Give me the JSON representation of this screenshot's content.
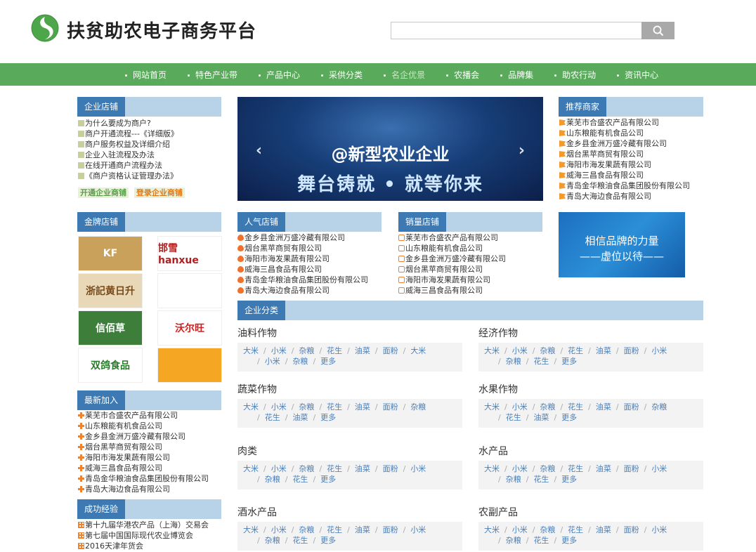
{
  "header": {
    "title": "扶贫助农电子商务平台",
    "search": {
      "value": "",
      "placeholder": ""
    },
    "search_icon": "search-icon"
  },
  "nav": {
    "items": [
      "网站首页",
      "特色产业带",
      "产品中心",
      "采供分类",
      "名企优景",
      "农播会",
      "品牌集",
      "助农行动",
      "资讯中心"
    ],
    "active": "名企优景"
  },
  "shop_intro": {
    "title": "企业店铺",
    "items": [
      "为什么要成为商户?",
      "商户开通流程---《详细版》",
      "商户服务权益及详细介绍",
      "企业入驻流程及办法",
      "在线开通商户流程办法",
      "《商户资格认证管理办法》"
    ],
    "promo": [
      "开通企业商铺",
      "登录企业商铺"
    ]
  },
  "gold_shops": {
    "title": "金牌店铺",
    "brands": [
      {
        "text": "KF",
        "bg": "#c9a15a",
        "color": "#fff"
      },
      {
        "text": "邯雪 hanxue",
        "bg": "#ffffff",
        "color": "#b02020"
      },
      {
        "text": "浙記黄日升",
        "bg": "#e9d8b8",
        "color": "#7a4a1a"
      },
      {
        "text": "",
        "bg": "#ffffff",
        "color": "#c02020"
      },
      {
        "text": "信佰草",
        "bg": "#3d7f3a",
        "color": "#ffffff"
      },
      {
        "text": "沃尔旺",
        "bg": "#ffffff",
        "color": "#d02020"
      },
      {
        "text": "双鸽食品",
        "bg": "#ffffff",
        "color": "#2b7a2b"
      },
      {
        "text": "",
        "bg": "#f5a623",
        "color": "#ffffff"
      }
    ]
  },
  "banner": {
    "line1": "@新型农业企业",
    "line2": "舞台铸就 • 就等你来",
    "prev_icon": "chevron-left-icon",
    "next_icon": "chevron-right-icon"
  },
  "recommend": {
    "title": "推荐商家",
    "items": [
      "莱芜市合盛农产品有限公司",
      "山东粮能有机食品公司",
      "金乡县金洲万盛冷藏有限公司",
      "烟台黑苹商贸有限公司",
      "海阳市海发果蔬有限公司",
      "威海三昌食品有限公司",
      "青岛金华粮油食品集团股份有限公司",
      "青岛大海边食品有限公司"
    ]
  },
  "popular": {
    "title": "人气店铺",
    "items": [
      "金乡县金洲万盛冷藏有限公司",
      "烟台黑苹商贸有限公司",
      "海阳市海发果蔬有限公司",
      "威海三昌食品有限公司",
      "青岛金华粮油食品集团股份有限公司",
      "青岛大海边食品有限公司"
    ]
  },
  "sales": {
    "title": "销量店铺",
    "items": [
      "莱芜市合盛农产品有限公司",
      "山东粮能有机食品公司",
      "金乡县金洲万盛冷藏有限公司",
      "烟台黑苹商贸有限公司",
      "海阳市海发果蔬有限公司",
      "威海三昌食品有限公司"
    ]
  },
  "ad": {
    "line1": "相信品牌的力量",
    "line2": "——虚位以待——"
  },
  "latest": {
    "title": "最新加入",
    "items": [
      "莱芜市合盛农产品有限公司",
      "山东粮能有机食品公司",
      "金乡县金洲万盛冷藏有限公司",
      "烟台黑苹商贸有限公司",
      "海阳市海发果蔬有限公司",
      "威海三昌食品有限公司",
      "青岛金华粮油食品集团股份有限公司",
      "青岛大海边食品有限公司"
    ]
  },
  "experience": {
    "title": "成功经验",
    "items": [
      "第十九届华港农产品（上海）交易会",
      "第七届中国国际现代农业博览会",
      "2016天津年货会"
    ]
  },
  "categories": {
    "title": "企业分类",
    "groups": [
      {
        "name": "油料作物",
        "row1": [
          "大米",
          "小米",
          "杂粮",
          "花生",
          "油菜",
          "面粉",
          "大米"
        ],
        "row2": [
          "小米",
          "杂粮",
          "更多"
        ]
      },
      {
        "name": "经济作物",
        "row1": [
          "大米",
          "小米",
          "杂粮",
          "花生",
          "油菜",
          "面粉",
          "小米"
        ],
        "row2": [
          "杂粮",
          "花生",
          "更多"
        ]
      },
      {
        "name": "蔬菜作物",
        "row1": [
          "大米",
          "小米",
          "杂粮",
          "花生",
          "油菜",
          "面粉",
          "杂粮"
        ],
        "row2": [
          "花生",
          "油菜",
          "更多"
        ]
      },
      {
        "name": "水果作物",
        "row1": [
          "大米",
          "小米",
          "杂粮",
          "花生",
          "油菜",
          "面粉",
          "杂粮"
        ],
        "row2": [
          "花生",
          "油菜",
          "更多"
        ]
      },
      {
        "name": "肉类",
        "row1": [
          "大米",
          "小米",
          "杂粮",
          "花生",
          "油菜",
          "面粉",
          "小米"
        ],
        "row2": [
          "杂粮",
          "花生",
          "更多"
        ]
      },
      {
        "name": "水产品",
        "row1": [
          "大米",
          "小米",
          "杂粮",
          "花生",
          "油菜",
          "面粉",
          "小米"
        ],
        "row2": [
          "杂粮",
          "花生",
          "更多"
        ]
      },
      {
        "name": "酒水产品",
        "row1": [
          "大米",
          "小米",
          "杂粮",
          "花生",
          "油菜",
          "面粉",
          "小米"
        ],
        "row2": [
          "杂粮",
          "花生",
          "更多"
        ]
      },
      {
        "name": "农副产品",
        "row1": [
          "大米",
          "小米",
          "杂粮",
          "花生",
          "油菜",
          "面粉",
          "小米"
        ],
        "row2": [
          "杂粮",
          "花生",
          "更多"
        ]
      }
    ]
  }
}
